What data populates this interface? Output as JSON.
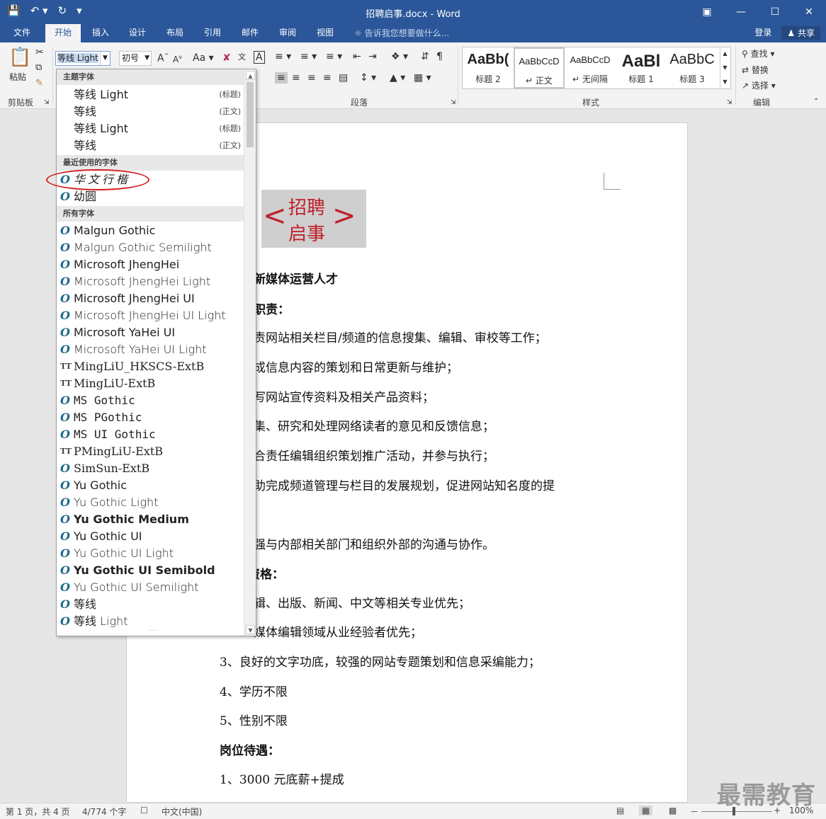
{
  "window": {
    "title": "招聘启事.docx - Word",
    "qat": [
      "save-icon",
      "undo-icon",
      "redo-icon",
      "customize-icon"
    ],
    "controls": [
      "ribbon-display-icon",
      "minimize-icon",
      "maximize-icon",
      "close-icon"
    ]
  },
  "tabs": [
    "文件",
    "开始",
    "插入",
    "设计",
    "布局",
    "引用",
    "邮件",
    "审阅",
    "视图"
  ],
  "tell_me": "告诉我您想要做什么...",
  "login": "登录",
  "share": "共享",
  "ribbon": {
    "clipboard": {
      "paste": "粘贴",
      "label": "剪贴板"
    },
    "font": {
      "name": "等线 Light",
      "size": "初号",
      "grow": "A",
      "shrink": "A",
      "case": "Aa"
    },
    "paragraph_label": "段落",
    "styles_label": "样式",
    "editing_label": "编辑",
    "styles": [
      {
        "preview": "AaBb(",
        "name": "标题 2"
      },
      {
        "preview": "AaBbCcD",
        "name": "正文"
      },
      {
        "preview": "AaBbCcD",
        "name": "无间隔"
      },
      {
        "preview": "AaBl",
        "name": "标题 1"
      },
      {
        "preview": "AaBbC",
        "name": "标题 3"
      }
    ],
    "editing": {
      "find": "查找",
      "replace": "替换",
      "select": "选择"
    }
  },
  "font_dropdown": {
    "theme_header": "主题字体",
    "theme_fonts": [
      {
        "name": "等线 Light",
        "tag": "(标题)"
      },
      {
        "name": "等线",
        "tag": "(正文)"
      },
      {
        "name": "等线 Light",
        "tag": "(标题)"
      },
      {
        "name": "等线",
        "tag": "(正文)"
      }
    ],
    "recent_header": "最近使用的字体",
    "recent_fonts": [
      "华文行楷",
      "幼圆"
    ],
    "all_header": "所有字体",
    "all_fonts": [
      "Malgun Gothic",
      "Malgun Gothic Semilight",
      "Microsoft JhengHei",
      "Microsoft JhengHei Light",
      "Microsoft JhengHei UI",
      "Microsoft JhengHei UI Light",
      "Microsoft YaHei UI",
      "Microsoft YaHei UI Light",
      "MingLiU_HKSCS-ExtB",
      "MingLiU-ExtB",
      "MS Gothic",
      "MS PGothic",
      "MS UI Gothic",
      "PMingLiU-ExtB",
      "SimSun-ExtB",
      "Yu Gothic",
      "Yu Gothic Light",
      "Yu Gothic Medium",
      "Yu Gothic UI",
      "Yu Gothic UI Light",
      "Yu Gothic UI Semibold",
      "Yu Gothic UI Semilight",
      "等线",
      "等线 Light"
    ],
    "all_font_icons": [
      "O",
      "O",
      "O",
      "O",
      "O",
      "O",
      "O",
      "O",
      "T",
      "T",
      "O",
      "O",
      "O",
      "T",
      "O",
      "O",
      "O",
      "O",
      "O",
      "O",
      "O",
      "O",
      "O",
      "O"
    ]
  },
  "document": {
    "banner": {
      "lt": "<",
      "gt": ">",
      "line1": "招聘",
      "line2": "启事"
    },
    "lines": [
      {
        "text": "新媒体运营人才",
        "bold": true
      },
      {
        "text": "职责：",
        "bold": true
      },
      {
        "text": "责网站相关栏目/频道的信息搜集、编辑、审校等工作；",
        "bold": false
      },
      {
        "text": "成信息内容的策划和日常更新与维护；",
        "bold": false
      },
      {
        "text": "写网站宣传资料及相关产品资料；",
        "bold": false
      },
      {
        "text": "集、研究和处理网络读者的意见和反馈信息；",
        "bold": false
      },
      {
        "text": "合责任编辑组织策划推广活动，并参与执行；",
        "bold": false
      },
      {
        "text": "助完成频道管理与栏目的发展规划，促进网站知名度的提",
        "bold": false
      },
      {
        "text": "强与内部相关部门和组织外部的沟通与协作。",
        "bold": false
      },
      {
        "text": "资格：",
        "bold": true
      },
      {
        "text": "辑、出版、新闻、中文等相关专业优先；",
        "bold": false
      },
      {
        "text": "媒体编辑领域从业经验者优先；",
        "bold": false
      },
      {
        "text": "3、良好的文字功底，较强的网站专题策划和信息采编能力；",
        "bold": false
      },
      {
        "text": "4、学历不限",
        "bold": false
      },
      {
        "text": "5、性别不限",
        "bold": false
      },
      {
        "text": "岗位待遇：",
        "bold": true
      },
      {
        "text": "1、3000 元底薪+提成",
        "bold": false
      }
    ]
  },
  "statusbar": {
    "page": "第 1 页，共 4 页",
    "words": "4/774 个字",
    "lang": "中文(中国)",
    "zoom": "100%",
    "zoom_minus": "－",
    "zoom_plus": "+"
  },
  "watermark": "最需教育",
  "colors": {
    "accent": "#2b579a",
    "highlight_ring": "#d62020",
    "banner_text": "#c0202a"
  }
}
